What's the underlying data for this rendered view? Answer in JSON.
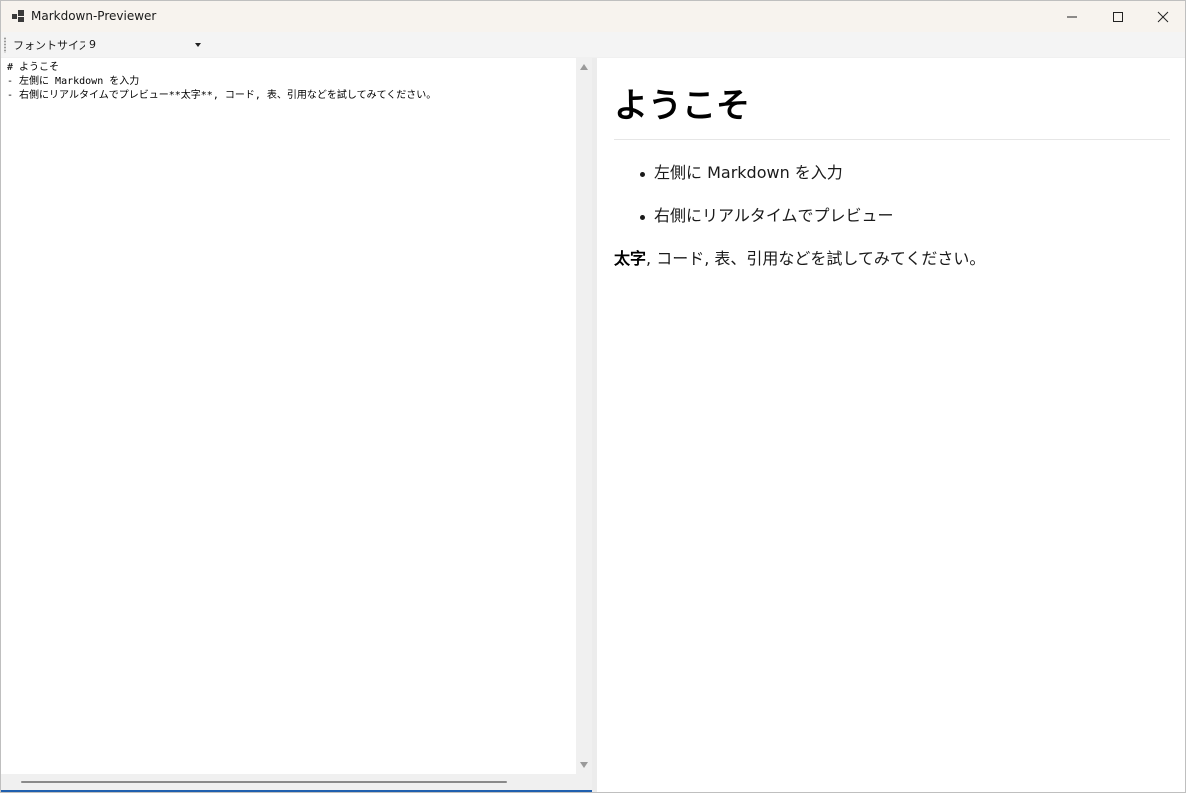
{
  "window": {
    "title": "Markdown-Previewer",
    "controls": {
      "minimize_icon": "minimize-icon",
      "maximize_icon": "maximize-icon",
      "close_icon": "close-icon"
    }
  },
  "toolbar": {
    "font_size_label": "フォントサイズ:",
    "font_size_value": "9"
  },
  "editor": {
    "lines": [
      "# ようこそ",
      "- 左側に Markdown を入力",
      "- 右側にリアルタイムでプレビュー**太字**, コード, 表、引用などを試してみてください。"
    ]
  },
  "preview": {
    "heading": "ようこそ",
    "list_items": [
      "左側に Markdown を入力",
      "右側にリアルタイムでプレビュー"
    ],
    "paragraph_bold": "太字",
    "paragraph_rest": ", コード, 表、引用などを試してみてください。"
  },
  "colors": {
    "titlebar": "#f7f3ee",
    "accent": "#1f5fae"
  }
}
